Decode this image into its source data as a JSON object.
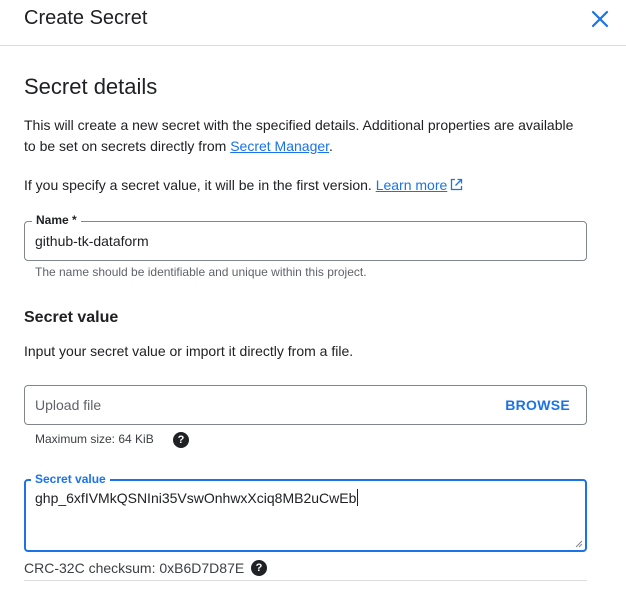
{
  "header": {
    "title": "Create Secret",
    "close_icon": "close-icon"
  },
  "details": {
    "title": "Secret details",
    "intro_text": "This will create a new secret with the specified details. Additional properties are available to be set on secrets directly from ",
    "intro_link": "Secret Manager",
    "intro_end": ".",
    "version_text": "If you specify a secret value, it will be in the first version. ",
    "learn_more_link": "Learn more"
  },
  "name_field": {
    "label": "Name *",
    "value": "github-tk-dataform",
    "hint": "The name should be identifiable and unique within this project."
  },
  "secret_value_section": {
    "title": "Secret value",
    "description": "Input your secret value or import it directly from a file."
  },
  "upload_field": {
    "placeholder": "Upload file",
    "browse_label": "BROWSE",
    "hint": "Maximum size: 64 KiB"
  },
  "secret_field": {
    "label": "Secret value",
    "value": "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",
    "checksum": "CRC-32C checksum: 0xB6D7D87E"
  },
  "colors": {
    "accent": "#1a73e8",
    "focus_border": "#1a73e8"
  }
}
